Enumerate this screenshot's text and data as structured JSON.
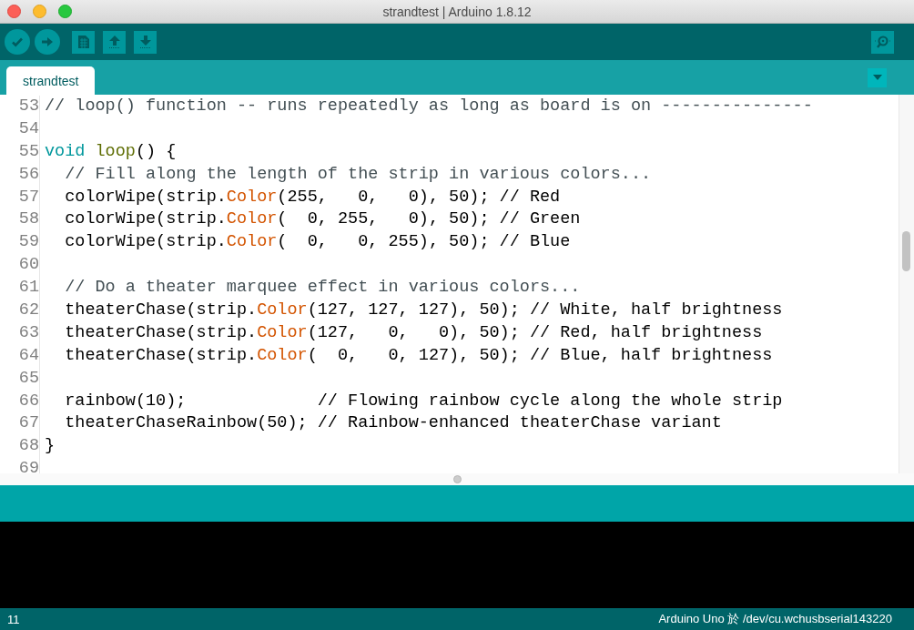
{
  "window": {
    "title": "strandtest | Arduino 1.8.12"
  },
  "tabs": [
    {
      "label": "strandtest",
      "selected": true
    }
  ],
  "editor": {
    "lines": [
      {
        "number": "53",
        "tokens": [
          {
            "kind": "comment",
            "text": "// loop() function -- runs repeatedly as long as board is on ---------------"
          }
        ]
      },
      {
        "number": "54"
      },
      {
        "number": "55",
        "tokens": [
          {
            "kind": "keyword",
            "text": "void "
          },
          {
            "kind": "function",
            "text": "loop"
          },
          {
            "kind": "plain",
            "text": "() {"
          }
        ]
      },
      {
        "number": "56",
        "tokens": [
          {
            "kind": "comment",
            "text": "  // Fill along the length of the strip in various colors..."
          }
        ]
      },
      {
        "number": "57",
        "tokens": [
          {
            "kind": "plain",
            "text": "  colorWipe(strip."
          },
          {
            "kind": "method",
            "text": "Color"
          },
          {
            "kind": "plain",
            "text": "(255,   0,   0), 50); // Red"
          }
        ]
      },
      {
        "number": "58",
        "tokens": [
          {
            "kind": "plain",
            "text": "  colorWipe(strip."
          },
          {
            "kind": "method",
            "text": "Color"
          },
          {
            "kind": "plain",
            "text": "(  0, 255,   0), 50); // Green"
          }
        ]
      },
      {
        "number": "59",
        "tokens": [
          {
            "kind": "plain",
            "text": "  colorWipe(strip."
          },
          {
            "kind": "method",
            "text": "Color"
          },
          {
            "kind": "plain",
            "text": "(  0,   0, 255), 50); // Blue"
          }
        ]
      },
      {
        "number": "60"
      },
      {
        "number": "61",
        "tokens": [
          {
            "kind": "comment",
            "text": "  // Do a theater marquee effect in various colors..."
          }
        ]
      },
      {
        "number": "62",
        "tokens": [
          {
            "kind": "plain",
            "text": "  theaterChase(strip."
          },
          {
            "kind": "method",
            "text": "Color"
          },
          {
            "kind": "plain",
            "text": "(127, 127, 127), 50); // White, half brightness"
          }
        ]
      },
      {
        "number": "63",
        "tokens": [
          {
            "kind": "plain",
            "text": "  theaterChase(strip."
          },
          {
            "kind": "method",
            "text": "Color"
          },
          {
            "kind": "plain",
            "text": "(127,   0,   0), 50); // Red, half brightness"
          }
        ]
      },
      {
        "number": "64",
        "tokens": [
          {
            "kind": "plain",
            "text": "  theaterChase(strip."
          },
          {
            "kind": "method",
            "text": "Color"
          },
          {
            "kind": "plain",
            "text": "(  0,   0, 127), 50); // Blue, half brightness"
          }
        ]
      },
      {
        "number": "65"
      },
      {
        "number": "66",
        "tokens": [
          {
            "kind": "plain",
            "text": "  rainbow(10);             // Flowing rainbow cycle along the whole strip"
          }
        ]
      },
      {
        "number": "67",
        "tokens": [
          {
            "kind": "plain",
            "text": "  theaterChaseRainbow(50); // Rainbow-enhanced theaterChase variant"
          }
        ]
      },
      {
        "number": "68",
        "tokens": [
          {
            "kind": "plain",
            "text": "}"
          }
        ]
      },
      {
        "number": "69"
      }
    ]
  },
  "status_bar": {
    "line": "11",
    "board": "Arduino Uno 於 /dev/cu.wchusbserial143220"
  }
}
